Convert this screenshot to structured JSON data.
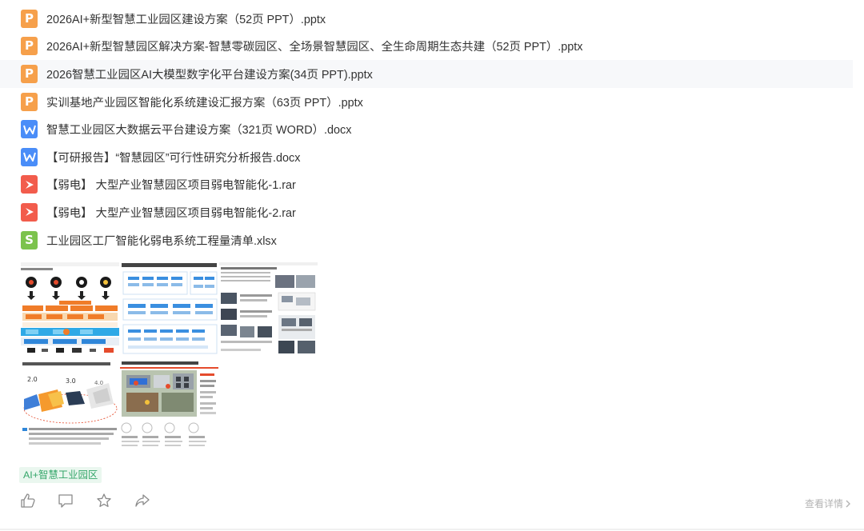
{
  "files": [
    {
      "type": "ppt",
      "icon": "ppt-file-icon",
      "name": "2026AI+新型智慧工业园区建设方案（52页 PPT）.pptx"
    },
    {
      "type": "ppt",
      "icon": "ppt-file-icon",
      "name": "2026AI+新型智慧园区解决方案-智慧零碳园区、全场景智慧园区、全生命周期生态共建（52页 PPT）.pptx"
    },
    {
      "type": "ppt",
      "icon": "ppt-file-icon",
      "name": "2026智慧工业园区AI大模型数字化平台建设方案(34页 PPT).pptx"
    },
    {
      "type": "ppt",
      "icon": "ppt-file-icon",
      "name": "实训基地产业园区智能化系统建设汇报方案（63页 PPT）.pptx"
    },
    {
      "type": "word",
      "icon": "word-file-icon",
      "name": "智慧工业园区大数据云平台建设方案（321页 WORD）.docx"
    },
    {
      "type": "word",
      "icon": "word-file-icon",
      "name": "【可研报告】“智慧园区”可行性研究分析报告.docx"
    },
    {
      "type": "pdf",
      "icon": "pdf-file-icon",
      "name": "【弱电】 大型产业智慧园区项目弱电智能化-1.rar"
    },
    {
      "type": "pdf",
      "icon": "pdf-file-icon",
      "name": "【弱电】 大型产业智慧园区项目弱电智能化-2.rar"
    },
    {
      "type": "excel",
      "icon": "excel-file-icon",
      "name": "工业园区工厂智能化弱电系统工程量清单.xlsx"
    }
  ],
  "thumbnails": {
    "t1": {
      "chips": [
        "2.0",
        "3.0",
        "4.0"
      ]
    },
    "t2": {
      "title": "“园区协同+业务在线+价值服务，实现业务闭环，"
    },
    "t3": {
      "title": "智慧园区，AI全面赋能"
    },
    "t4": {
      "title": "从信息化到工业互联网数字化、智慧化、低碳化",
      "labels": [
        "2.0",
        "3.0",
        "4.0"
      ]
    },
    "t5": {
      "title": "智能分析：打造智慧园区系统体系"
    }
  },
  "tag": {
    "label": "AI+智慧工业园区"
  },
  "actions": {
    "like_icon": "thumbs-up-icon",
    "comment_icon": "comment-icon",
    "favorite_icon": "star-icon",
    "share_icon": "share-icon",
    "details_label": "查看详情"
  },
  "colors": {
    "ppt": "#f6a04b",
    "word": "#4a8df8",
    "pdf": "#f25c4c",
    "excel": "#7cc34d",
    "tag_bg": "#eaf7ef",
    "tag_text": "#35a66a"
  }
}
